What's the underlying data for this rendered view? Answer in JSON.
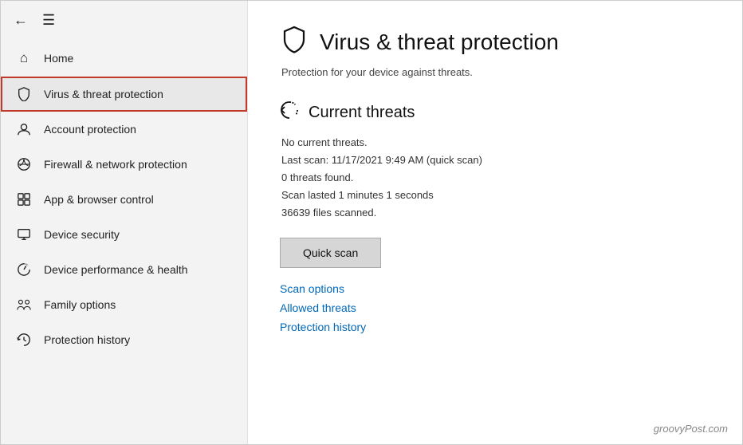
{
  "sidebar": {
    "back_icon": "←",
    "hamburger_icon": "☰",
    "items": [
      {
        "id": "home",
        "label": "Home",
        "icon": "⌂"
      },
      {
        "id": "virus-threat",
        "label": "Virus & threat protection",
        "icon": "🛡",
        "active": true
      },
      {
        "id": "account",
        "label": "Account protection",
        "icon": "👤"
      },
      {
        "id": "firewall",
        "label": "Firewall & network protection",
        "icon": "📡"
      },
      {
        "id": "app-browser",
        "label": "App & browser control",
        "icon": "⊞"
      },
      {
        "id": "device-security",
        "label": "Device security",
        "icon": "🖥"
      },
      {
        "id": "device-performance",
        "label": "Device performance & health",
        "icon": "♡"
      },
      {
        "id": "family",
        "label": "Family options",
        "icon": "👨‍👩‍👧"
      },
      {
        "id": "protection-history",
        "label": "Protection history",
        "icon": "↺"
      }
    ]
  },
  "main": {
    "page_icon": "🛡",
    "page_title": "Virus & threat protection",
    "page_subtitle": "Protection for your device against threats.",
    "section_icon": "🔄",
    "section_title": "Current threats",
    "threats_lines": [
      "No current threats.",
      "Last scan: 11/17/2021 9:49 AM (quick scan)",
      "0 threats found.",
      "Scan lasted 1 minutes 1 seconds",
      "36639 files scanned."
    ],
    "quick_scan_label": "Quick scan",
    "scan_options_label": "Scan options",
    "allowed_threats_label": "Allowed threats",
    "protection_history_label": "Protection history",
    "watermark": "groovyPost.com"
  }
}
